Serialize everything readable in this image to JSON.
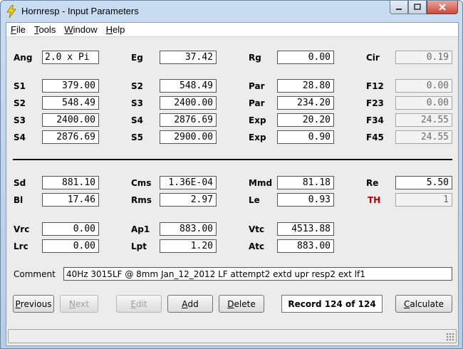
{
  "window": {
    "title": "Hornresp - Input Parameters",
    "caption_buttons": [
      "minimize",
      "maximize",
      "close"
    ]
  },
  "menu": [
    {
      "label": "File",
      "key": "F",
      "rest": "ile"
    },
    {
      "label": "Tools",
      "key": "T",
      "rest": "ools"
    },
    {
      "label": "Window",
      "key": "W",
      "rest": "indow"
    },
    {
      "label": "Help",
      "key": "H",
      "rest": "elp"
    }
  ],
  "params": {
    "Ang": "2.0 x Pi",
    "Eg": "37.42",
    "Rg": "0.00",
    "Cir": "0.19",
    "S1": "379.00",
    "S2a": "548.49",
    "Par1": "28.80",
    "F12": "0.00",
    "S2b": "548.49",
    "S3a": "2400.00",
    "Par2": "234.20",
    "F23": "0.00",
    "S3b": "2400.00",
    "S4a": "2876.69",
    "Exp1": "20.20",
    "F34": "24.55",
    "S4b": "2876.69",
    "S5": "2900.00",
    "Exp2": "0.90",
    "F45": "24.55",
    "Sd": "881.10",
    "Cms": "1.36E-04",
    "Mmd": "81.18",
    "Re": "5.50",
    "Bl": "17.46",
    "Rms": "2.97",
    "Le": "0.93",
    "TH": "1",
    "Vrc": "0.00",
    "Ap1": "883.00",
    "Vtc": "4513.88",
    "Lrc": "0.00",
    "Lpt": "1.20",
    "Atc": "883.00"
  },
  "labels": {
    "Ang": "Ang",
    "Eg": "Eg",
    "Rg": "Rg",
    "Cir": "Cir",
    "S1": "S1",
    "S2": "S2",
    "Par": "Par",
    "F12": "F12",
    "S3": "S3",
    "F23": "F23",
    "S4": "S4",
    "Exp": "Exp",
    "F34": "F34",
    "S5": "S5",
    "F45": "F45",
    "Sd": "Sd",
    "Cms": "Cms",
    "Mmd": "Mmd",
    "Re": "Re",
    "Bl": "Bl",
    "Rms": "Rms",
    "Le": "Le",
    "TH": "TH",
    "Vrc": "Vrc",
    "Ap1": "Ap1",
    "Vtc": "Vtc",
    "Lrc": "Lrc",
    "Lpt": "Lpt",
    "Atc": "Atc",
    "Comment": "Comment"
  },
  "comment": "40Hz 3015LF @ 8mm Jan_12_2012 LF attempt2 extd upr resp2 ext lf1",
  "buttons": {
    "previous": {
      "key": "P",
      "rest": "revious"
    },
    "next": {
      "key": "N",
      "rest": "ext"
    },
    "edit": {
      "key": "E",
      "rest": "dit"
    },
    "add": {
      "key": "A",
      "rest": "dd"
    },
    "delete": {
      "key": "D",
      "rest": "elete"
    },
    "calculate": {
      "key": "C",
      "rest": "alculate"
    }
  },
  "record": "Record 124 of 124",
  "colors": {
    "th_label": "#c00000",
    "close_button": "#c94a3a"
  }
}
